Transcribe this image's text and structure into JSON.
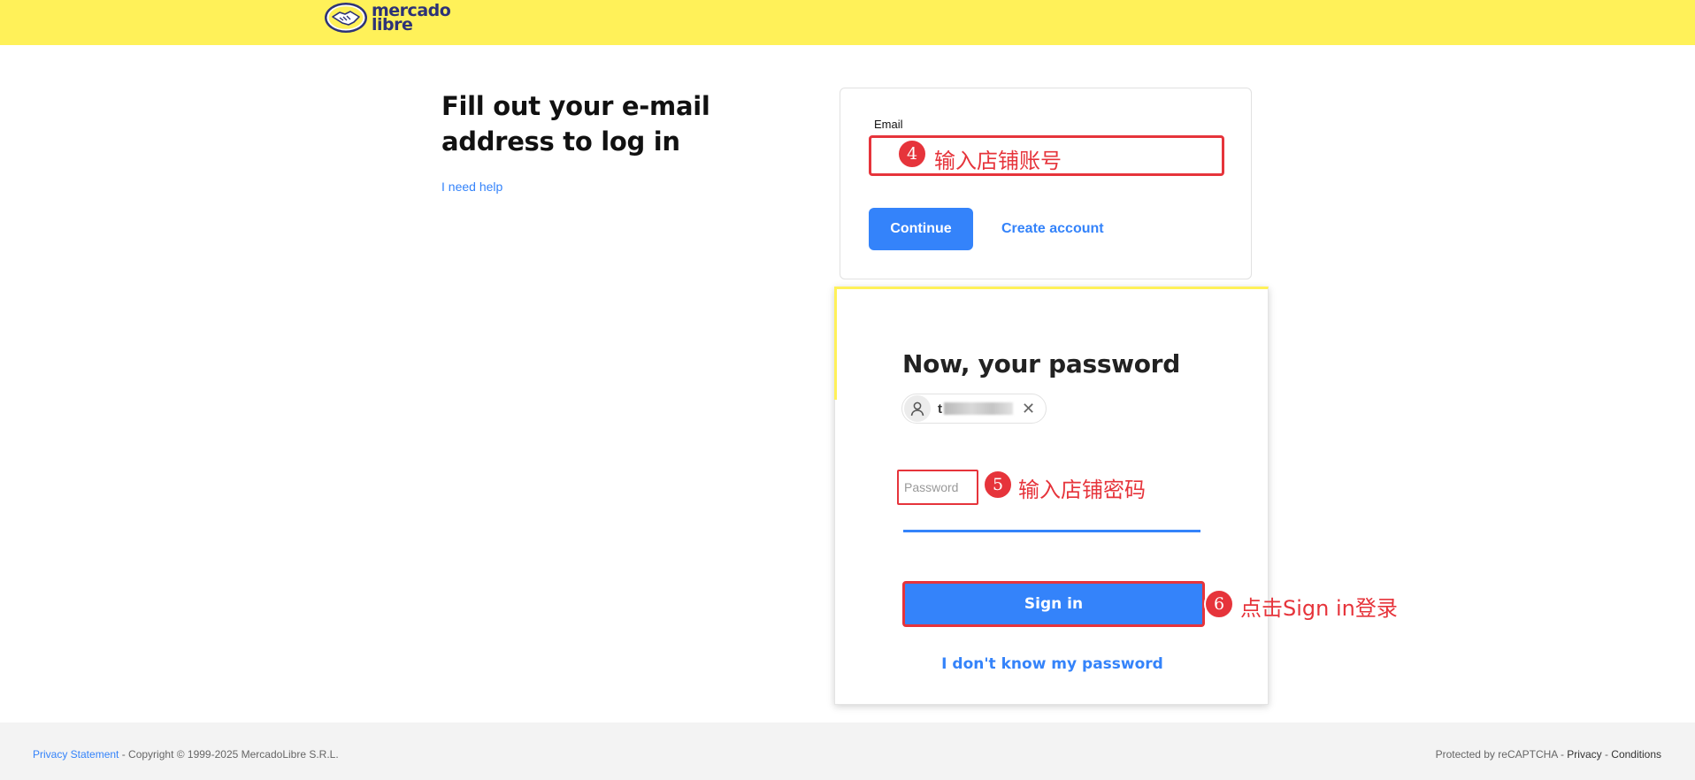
{
  "header": {
    "logo_line1": "mercado",
    "logo_line2": "libre"
  },
  "login": {
    "heading": "Fill out your e-mail address to log in",
    "help_link": "I need help",
    "email_label": "Email",
    "continue_label": "Continue",
    "create_account_label": "Create account"
  },
  "annotations": {
    "step4_num": "4",
    "step4_text": "输入店铺账号",
    "step5_num": "5",
    "step5_text": "输入店铺密码",
    "step6_num": "6",
    "step6_text": "点击Sign in登录"
  },
  "password_panel": {
    "title": "Now, your password",
    "user_initial": "t",
    "password_placeholder": "Password",
    "signin_label": "Sign in",
    "forgot_label": "I don't know my password"
  },
  "footer": {
    "privacy_link": "Privacy Statement",
    "copyright": " - Copyright © 1999-2025 MercadoLibre S.R.L.",
    "recaptcha_text": "Protected by reCAPTCHA - ",
    "privacy_label": "Privacy",
    "separator": " - ",
    "conditions_label": "Conditions"
  },
  "colors": {
    "header_bg": "#fff159",
    "accent_blue": "#3483fa",
    "annotation_red": "#e6343b",
    "footer_bg": "#f3f3f3"
  }
}
